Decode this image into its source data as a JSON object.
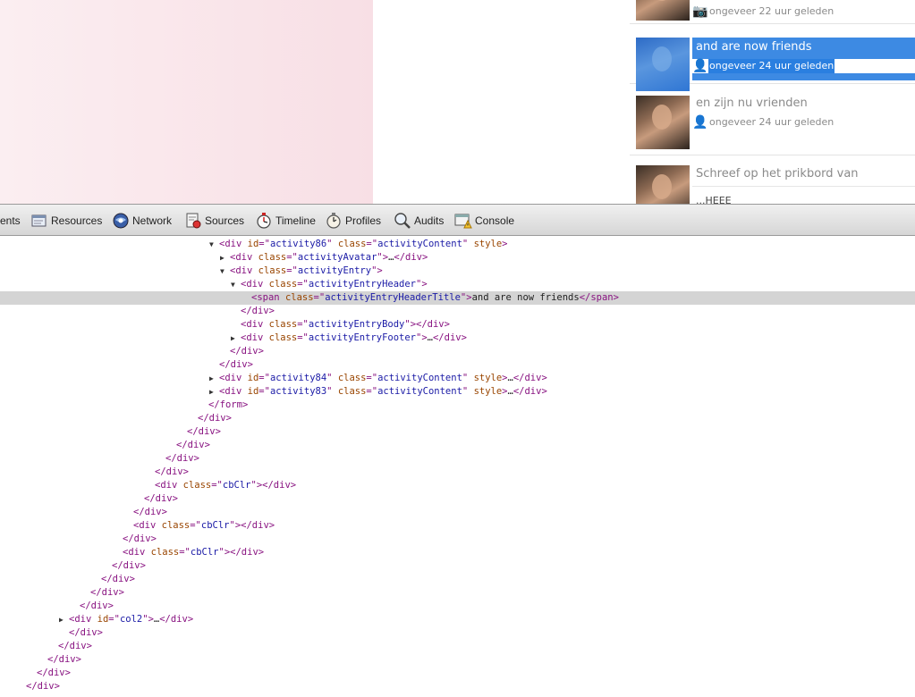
{
  "activity_feed": [
    {
      "title": "",
      "time": "ongeveer 22 uur geleden",
      "icon": "camera-icon",
      "highlight": false
    },
    {
      "title": "and are now friends",
      "time": "ongeveer 24 uur geleden",
      "icon": "add-friend-icon",
      "highlight": true
    },
    {
      "title": "en zijn nu vrienden",
      "time": "ongeveer 24 uur geleden",
      "icon": "add-friend-icon",
      "highlight": false
    },
    {
      "title": "Schreef op het prikbord van",
      "snippet": "...HEEE",
      "highlight": false
    }
  ],
  "toolbar": {
    "tabs": [
      {
        "label": "ents",
        "icon": "elements-icon"
      },
      {
        "label": "Resources",
        "icon": "resources-icon"
      },
      {
        "label": "Network",
        "icon": "network-icon"
      },
      {
        "label": "Sources",
        "icon": "sources-icon"
      },
      {
        "label": "Timeline",
        "icon": "timeline-icon"
      },
      {
        "label": "Profiles",
        "icon": "profiles-icon"
      },
      {
        "label": "Audits",
        "icon": "audits-icon"
      },
      {
        "label": "Console",
        "icon": "console-icon"
      }
    ]
  },
  "dom_lines": [
    {
      "indent": 19,
      "arrow": "down",
      "html": "<div id=\"activity86\" class=\"activityContent\" style>"
    },
    {
      "indent": 20,
      "arrow": "right",
      "html": "<div class=\"activityAvatar\">…</div>"
    },
    {
      "indent": 20,
      "arrow": "down",
      "html": "<div class=\"activityEntry\">"
    },
    {
      "indent": 21,
      "arrow": "down",
      "html": "<div class=\"activityEntryHeader\">"
    },
    {
      "indent": 22,
      "arrow": "",
      "selected": true,
      "html": "<span class=\"activityEntryHeaderTitle\">and are now friends</span>"
    },
    {
      "indent": 21,
      "arrow": "",
      "html": "</div>"
    },
    {
      "indent": 21,
      "arrow": "",
      "html": "<div class=\"activityEntryBody\"></div>"
    },
    {
      "indent": 21,
      "arrow": "right",
      "html": "<div class=\"activityEntryFooter\">…</div>"
    },
    {
      "indent": 20,
      "arrow": "",
      "html": "</div>"
    },
    {
      "indent": 19,
      "arrow": "",
      "html": "</div>"
    },
    {
      "indent": 19,
      "arrow": "right",
      "html": "<div id=\"activity84\" class=\"activityContent\" style>…</div>"
    },
    {
      "indent": 19,
      "arrow": "right",
      "html": "<div id=\"activity83\" class=\"activityContent\" style>…</div>"
    },
    {
      "indent": 18,
      "arrow": "",
      "html": "</form>"
    },
    {
      "indent": 17,
      "arrow": "",
      "html": "</div>"
    },
    {
      "indent": 16,
      "arrow": "",
      "html": "</div>"
    },
    {
      "indent": 15,
      "arrow": "",
      "html": "</div>"
    },
    {
      "indent": 14,
      "arrow": "",
      "html": "</div>"
    },
    {
      "indent": 13,
      "arrow": "",
      "html": "</div>"
    },
    {
      "indent": 13,
      "arrow": "",
      "html": "<div class=\"cbClr\"></div>"
    },
    {
      "indent": 12,
      "arrow": "",
      "html": "</div>"
    },
    {
      "indent": 11,
      "arrow": "",
      "html": "</div>"
    },
    {
      "indent": 11,
      "arrow": "",
      "html": "<div class=\"cbClr\"></div>"
    },
    {
      "indent": 10,
      "arrow": "",
      "html": "</div>"
    },
    {
      "indent": 10,
      "arrow": "",
      "html": "<div class=\"cbClr\"></div>"
    },
    {
      "indent": 9,
      "arrow": "",
      "html": "</div>"
    },
    {
      "indent": 8,
      "arrow": "",
      "html": "</div>"
    },
    {
      "indent": 7,
      "arrow": "",
      "html": "</div>"
    },
    {
      "indent": 6,
      "arrow": "",
      "html": "</div>"
    },
    {
      "indent": 5,
      "arrow": "right",
      "html": "<div id=\"col2\">…</div>"
    },
    {
      "indent": 5,
      "arrow": "",
      "html": "</div>"
    },
    {
      "indent": 4,
      "arrow": "",
      "html": "</div>"
    },
    {
      "indent": 3,
      "arrow": "",
      "html": "</div>"
    },
    {
      "indent": 2,
      "arrow": "",
      "html": "</div>"
    },
    {
      "indent": 1,
      "arrow": "",
      "html": "</div>"
    }
  ]
}
